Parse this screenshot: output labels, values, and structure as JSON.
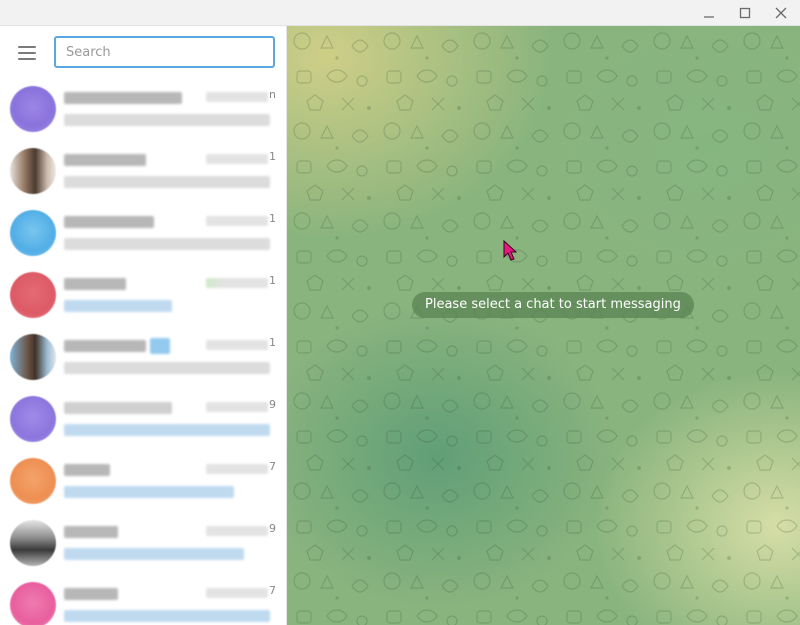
{
  "search": {
    "placeholder": "Search",
    "value": ""
  },
  "chat_area": {
    "empty_message": "Please select a chat to start messaging"
  },
  "colors": {
    "accent": "#5aa7e1",
    "pill_background": "#587f52"
  },
  "chats": [
    {
      "edge": "n"
    },
    {
      "edge": "1"
    },
    {
      "edge": "1"
    },
    {
      "edge": "1"
    },
    {
      "edge": "1"
    },
    {
      "edge": "9"
    },
    {
      "edge": "7"
    },
    {
      "edge": "9"
    },
    {
      "edge": "7"
    }
  ]
}
